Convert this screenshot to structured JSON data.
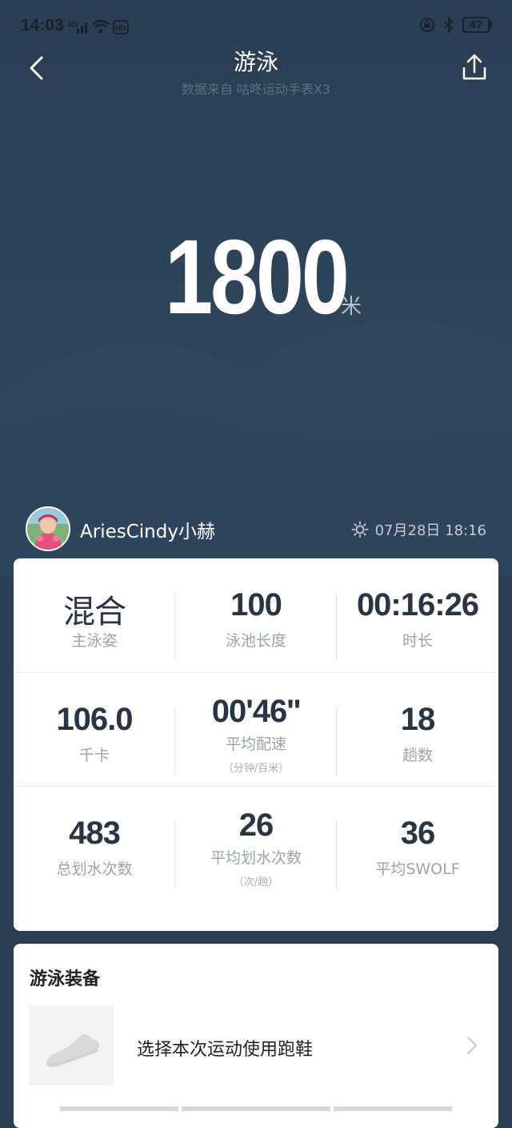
{
  "status_bar": {
    "time": "14:03",
    "network": "4G",
    "battery": "47"
  },
  "header": {
    "title": "游泳",
    "subtitle": "数据来自 咕咚运动手表X3"
  },
  "summary": {
    "distance": "1800",
    "unit": "米"
  },
  "user": {
    "name": "AriesCindy小赫",
    "datetime": "07月28日 18:16"
  },
  "stats": {
    "stroke": {
      "value": "混合",
      "label": "主泳姿"
    },
    "pool_length": {
      "value": "100",
      "label": "泳池长度"
    },
    "duration": {
      "value": "00:16:26",
      "label": "时长"
    },
    "calories": {
      "value": "106.0",
      "label": "千卡"
    },
    "pace": {
      "value": "00'46''",
      "label": "平均配速",
      "note": "（分钟/百米）"
    },
    "laps": {
      "value": "18",
      "label": "趟数"
    },
    "total_strokes": {
      "value": "483",
      "label": "总划水次数"
    },
    "avg_strokes": {
      "value": "26",
      "label": "平均划水次数",
      "note": "（次/趟）"
    },
    "swolf": {
      "value": "36",
      "label": "平均SWOLF"
    }
  },
  "equipment": {
    "title": "游泳装备",
    "select_text": "选择本次运动使用跑鞋"
  },
  "colors": {
    "background": "#2c3d52",
    "card": "#ffffff",
    "value_text": "#2b3443",
    "label_text": "#9ba2ac"
  },
  "icons": [
    "back-arrow-icon",
    "share-icon",
    "sun-icon",
    "shoe-icon",
    "chevron-right-icon"
  ]
}
